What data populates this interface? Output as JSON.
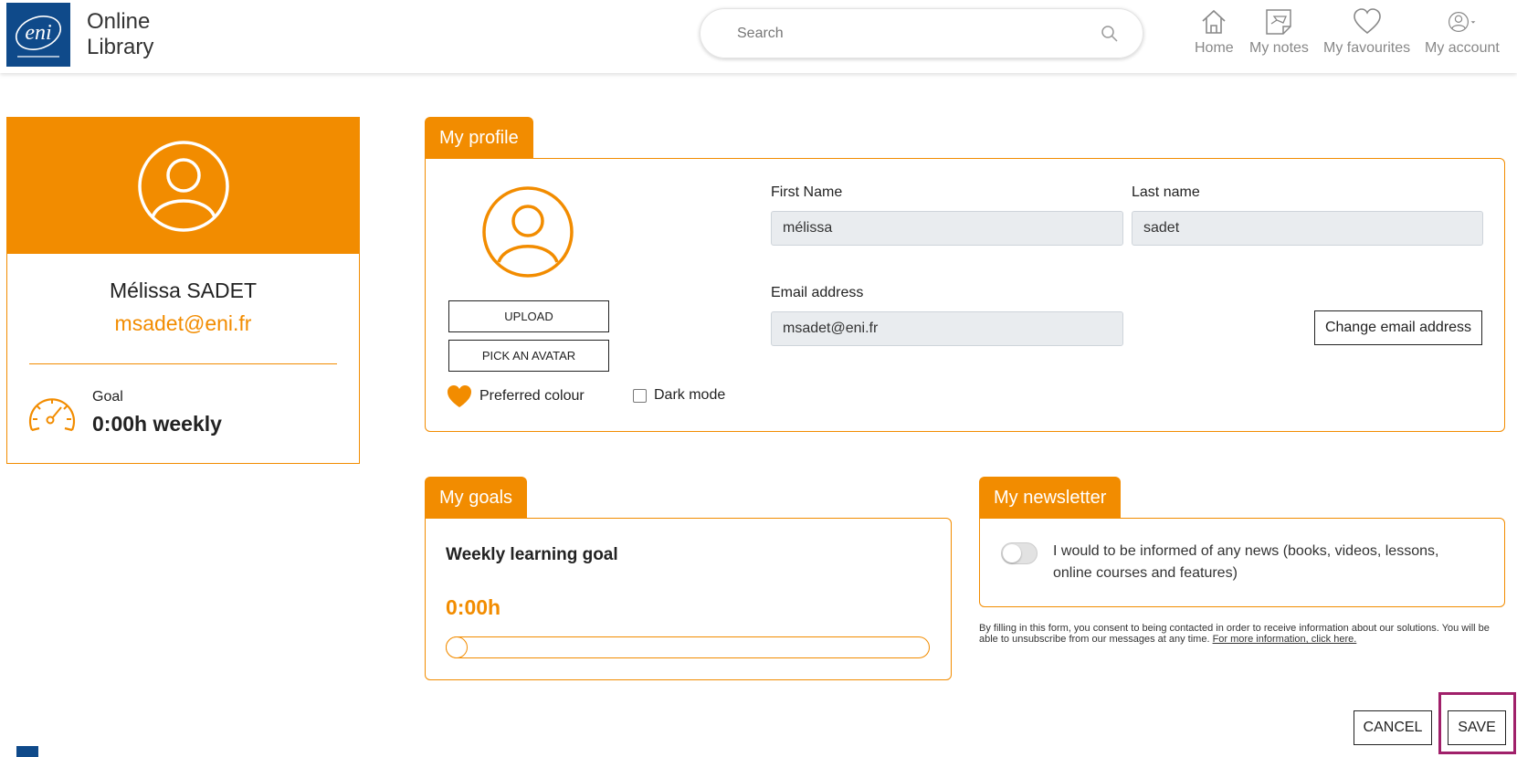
{
  "header": {
    "logo_text": "eni",
    "title_line1": "Online",
    "title_line2": "Library",
    "search_placeholder": "Search",
    "nav": [
      {
        "label": "Home",
        "icon": "home-icon"
      },
      {
        "label": "My notes",
        "icon": "notes-icon"
      },
      {
        "label": "My favourites",
        "icon": "heart-icon"
      },
      {
        "label": "My account",
        "icon": "account-icon"
      }
    ]
  },
  "profile_card": {
    "name": "Mélissa SADET",
    "email": "msadet@eni.fr",
    "goal_label": "Goal",
    "goal_value": "0:00h weekly"
  },
  "my_profile": {
    "tab_label": "My profile",
    "upload_label": "UPLOAD",
    "pick_avatar_label": "PICK AN AVATAR",
    "preferred_colour_label": "Preferred colour",
    "dark_mode_label": "Dark mode",
    "first_name_label": "First Name",
    "first_name_value": "mélissa",
    "last_name_label": "Last name",
    "last_name_value": "sadet",
    "email_label": "Email address",
    "email_value": "msadet@eni.fr",
    "change_email_label": "Change email address"
  },
  "my_goals": {
    "tab_label": "My goals",
    "title": "Weekly learning goal",
    "amount": "0:00h",
    "slider_fraction": 0
  },
  "my_newsletter": {
    "tab_label": "My newsletter",
    "text": "I would to be informed of any news (books, videos, lessons, online courses and features)",
    "consent_text": "By filling in this form, you consent to being contacted in order to receive information about our solutions. You will be able to unsubscribe from our messages at any time.",
    "consent_link": "For more information, click here.",
    "toggle_on": false
  },
  "actions": {
    "cancel_label": "CANCEL",
    "save_label": "SAVE"
  },
  "colors": {
    "accent": "#f28c00",
    "brand": "#0f4a8a",
    "highlight": "#a0206a"
  }
}
